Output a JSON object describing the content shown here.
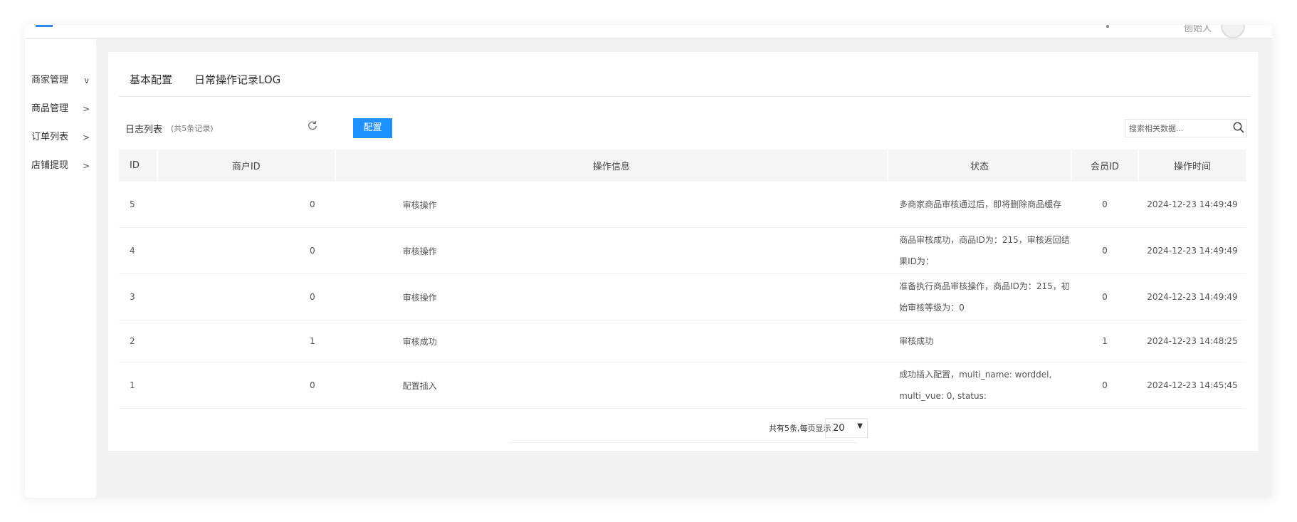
{
  "header": {
    "user_name": "创始人"
  },
  "sidebar": {
    "items": [
      {
        "label": "商家管理",
        "chevron": "∨"
      },
      {
        "label": "商品管理",
        "chevron": ">"
      },
      {
        "label": "订单列表",
        "chevron": ">"
      },
      {
        "label": "店铺提现",
        "chevron": ">"
      }
    ]
  },
  "tabs": [
    {
      "label": "基本配置"
    },
    {
      "label": "日常操作记录LOG"
    }
  ],
  "toolbar": {
    "title": "日志列表",
    "count": "(共5条记录)",
    "config_label": "配置",
    "search_placeholder": "搜索相关数据..."
  },
  "table": {
    "columns": [
      "ID",
      "商户ID",
      "操作信息",
      "状态",
      "会员ID",
      "操作时间"
    ],
    "rows": [
      {
        "id": "5",
        "merchant_id": "0",
        "info": "审核操作",
        "status": "多商家商品审核通过后，即将删除商品缓存",
        "member_id": "0",
        "time": "2024-12-23 14:49:49"
      },
      {
        "id": "4",
        "merchant_id": "0",
        "info": "审核操作",
        "status": "商品审核成功，商品ID为：215，审核返回结果ID为：",
        "member_id": "0",
        "time": "2024-12-23 14:49:49"
      },
      {
        "id": "3",
        "merchant_id": "0",
        "info": "审核操作",
        "status": "准备执行商品审核操作，商品ID为：215，初始审核等级为：0",
        "member_id": "0",
        "time": "2024-12-23 14:49:49"
      },
      {
        "id": "2",
        "merchant_id": "1",
        "info": "审核成功",
        "status": "审核成功",
        "member_id": "1",
        "time": "2024-12-23 14:48:25"
      },
      {
        "id": "1",
        "merchant_id": "0",
        "info": "配置插入",
        "status": "成功插入配置，multi_name: worddel, multi_vue: 0, status:",
        "member_id": "0",
        "time": "2024-12-23 14:45:45"
      }
    ]
  },
  "pager": {
    "summary": "共有5条,每页显示",
    "page_size": "20"
  }
}
